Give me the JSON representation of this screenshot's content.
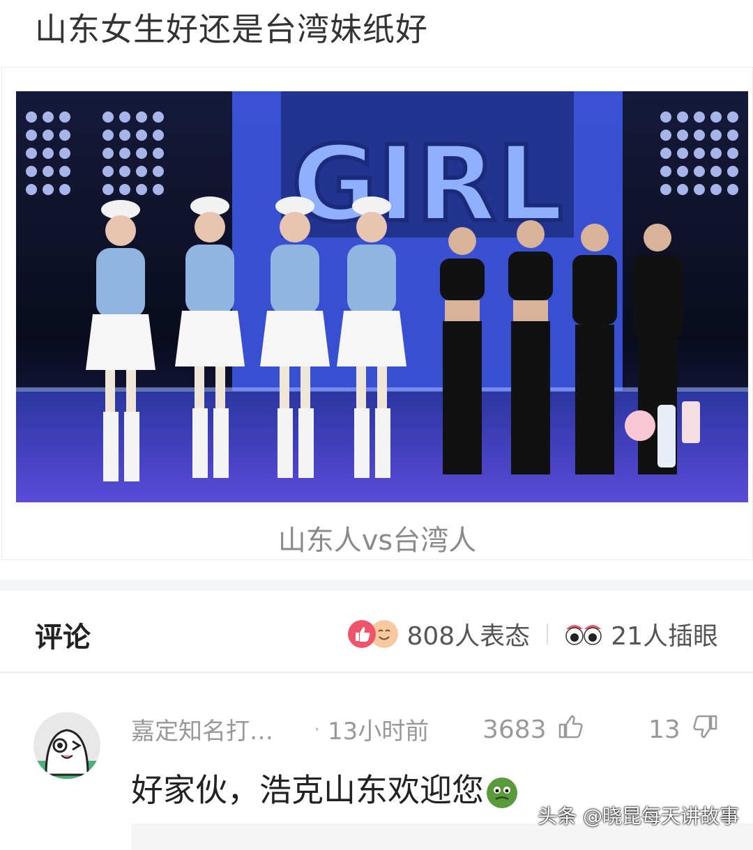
{
  "article": {
    "title": "山东女生好还是台湾妹纸好",
    "image_caption": "山东人vs台湾人",
    "stage_sign": "GIRL"
  },
  "comments": {
    "header_label": "评论",
    "reactions_count_label": "808人表态",
    "eye_roll_count_label": "21人插眼",
    "items": [
      {
        "username": "嘉定知名打…",
        "time": "13小时前",
        "likes": "3683",
        "dislikes": "13",
        "text": "好家伙，浩克山东欢迎您",
        "emoji": "hulk-emoji"
      }
    ]
  },
  "watermark": "头条 @晓昆每天讲故事",
  "colors": {
    "like_red": "#f0546a",
    "stage_blue": "#4a6cff",
    "muted_text": "#999999"
  }
}
